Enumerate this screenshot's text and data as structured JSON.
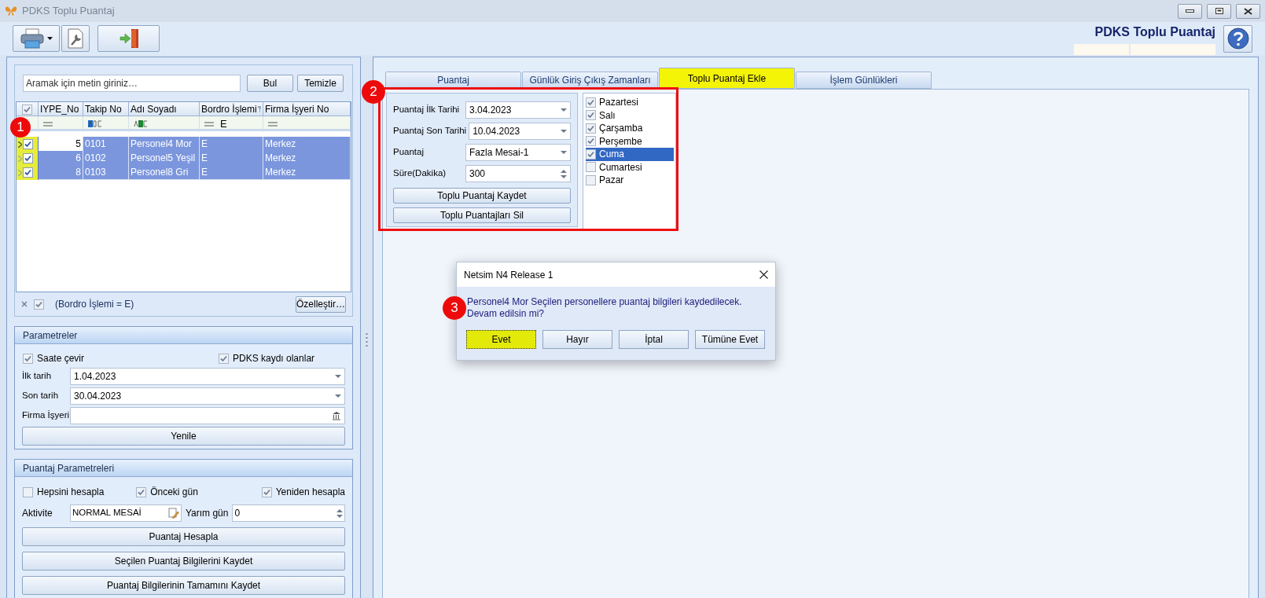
{
  "window": {
    "title": "PDKS Toplu Puantaj"
  },
  "header": {
    "title": "PDKS Toplu Puantaj"
  },
  "search": {
    "placeholder": "Aramak için metin giriniz…",
    "find": "Bul",
    "clear": "Temizle"
  },
  "grid": {
    "all_checked": true,
    "columns": [
      "IYPE_No",
      "Takip No",
      "Adı Soyadı",
      "Bordro İşlemi",
      "Firma İşyeri No"
    ],
    "filters": [
      {
        "kind": "equals"
      },
      {
        "kind": "begins"
      },
      {
        "kind": "contains"
      },
      {
        "kind": "equals",
        "text": "E"
      },
      {
        "kind": "equals"
      }
    ],
    "rows": [
      {
        "checked": true,
        "selected": true,
        "current": true,
        "highlighted": true,
        "cells": [
          "5",
          "0101",
          "Personel4 Mor",
          "E",
          "Merkez"
        ]
      },
      {
        "checked": true,
        "selected": true,
        "current": false,
        "highlighted": true,
        "cells": [
          "6",
          "0102",
          "Personel5 Yeşil",
          "E",
          "Merkez"
        ]
      },
      {
        "checked": true,
        "selected": true,
        "current": false,
        "highlighted": true,
        "cells": [
          "8",
          "0103",
          "Personel8 Gri",
          "E",
          "Merkez"
        ]
      }
    ],
    "filter_bar": {
      "enabled": true,
      "text": "(Bordro İşlemi = E)",
      "button": "Özelleştir…"
    }
  },
  "parameters": {
    "title": "Parametreler",
    "checks": [
      {
        "label": "Saate çevir",
        "checked": true
      },
      {
        "label": "PDKS kaydı olanlar",
        "checked": true
      }
    ],
    "fields": [
      {
        "label": "İlk tarih",
        "value": "1.04.2023",
        "kind": "dropdown"
      },
      {
        "label": "Son tarih",
        "value": "30.04.2023",
        "kind": "dropdown"
      },
      {
        "label": "Firma İşyeri",
        "kind": "lookup"
      }
    ],
    "button": "Yenile"
  },
  "puantaj_parameters": {
    "title": "Puantaj Parametreleri",
    "checks": [
      {
        "label": "Hepsini hesapla",
        "checked": false
      },
      {
        "label": "Önceki gün",
        "checked": true
      },
      {
        "label": "Yeniden hesapla",
        "checked": true
      }
    ],
    "activity": {
      "label": "Aktivite",
      "value": "NORMAL MESAİ"
    },
    "half_day": {
      "label": "Yarım gün",
      "value": "0"
    },
    "buttons": [
      "Puantaj Hesapla",
      "Seçilen Puantaj Bilgilerini Kaydet",
      "Puantaj Bilgilerinin Tamamını Kaydet"
    ]
  },
  "tabs": [
    {
      "label": "Puantaj",
      "selected": false
    },
    {
      "label": "Günlük Giriş Çıkış Zamanları",
      "selected": false
    },
    {
      "label": "Toplu Puantaj Ekle",
      "selected": true
    },
    {
      "label": "İşlem Günlükleri",
      "selected": false
    }
  ],
  "bulk_form": {
    "fields": [
      {
        "label": "Puantaj İlk Tarihi",
        "value": "3.04.2023",
        "kind": "dropdown"
      },
      {
        "label": "Puantaj Son Tarihi",
        "value": "10.04.2023",
        "kind": "dropdown"
      },
      {
        "label": "Puantaj",
        "value": "Fazla Mesai-1",
        "kind": "dropdown"
      },
      {
        "label": "Süre(Dakika)",
        "value": "300",
        "kind": "spin"
      }
    ],
    "buttons": [
      "Toplu Puantaj Kaydet",
      "Toplu Puantajları Sil"
    ],
    "days": [
      {
        "label": "Pazartesi",
        "checked": true,
        "selected": false
      },
      {
        "label": "Salı",
        "checked": true,
        "selected": false
      },
      {
        "label": "Çarşamba",
        "checked": true,
        "selected": false
      },
      {
        "label": "Perşembe",
        "checked": true,
        "selected": false
      },
      {
        "label": "Cuma",
        "checked": true,
        "selected": true
      },
      {
        "label": "Cumartesi",
        "checked": false,
        "selected": false
      },
      {
        "label": "Pazar",
        "checked": false,
        "selected": false
      }
    ]
  },
  "dialog": {
    "title": "Netsim N4 Release 1",
    "message": "Personel4 Mor Seçilen personellere puantaj bilgileri kaydedilecek.",
    "message_2": "Devam edilsin mi?",
    "buttons": [
      {
        "label": "Evet",
        "selected": true,
        "highlighted": true
      },
      {
        "label": "Hayır",
        "selected": false,
        "highlighted": false
      },
      {
        "label": "İptal",
        "selected": false,
        "highlighted": false
      },
      {
        "label": "Tümüne Evet",
        "selected": false,
        "highlighted": false
      }
    ]
  },
  "markers": [
    "1",
    "2",
    "3"
  ]
}
